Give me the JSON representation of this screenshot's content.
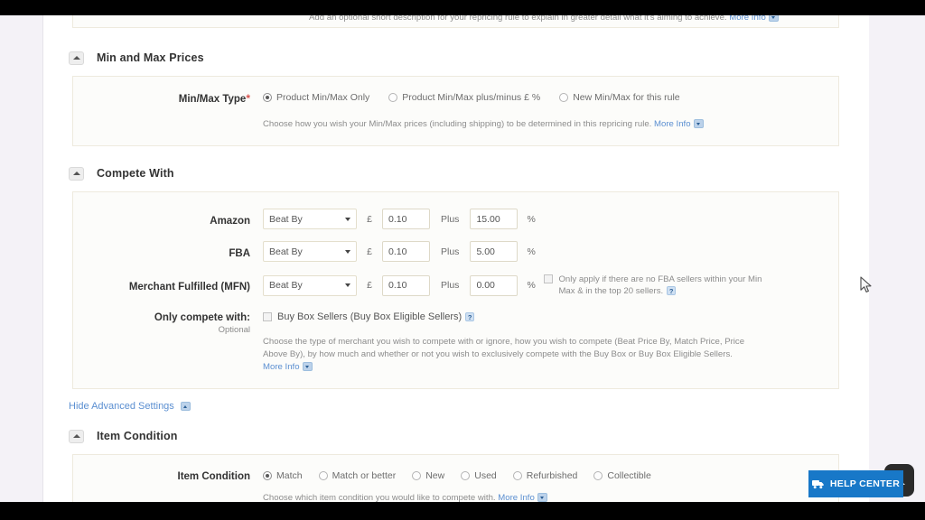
{
  "top_partial_panel": {
    "help_text": "Add an optional short description for your repricing rule to explain in greater detail what it's aiming to achieve.",
    "more_info": "More Info"
  },
  "sections": {
    "min_max": {
      "title": "Min and Max Prices",
      "field_label": "Min/Max Type",
      "required_mark": "*",
      "options": [
        {
          "label": "Product Min/Max Only",
          "selected": true
        },
        {
          "label": "Product Min/Max plus/minus £ %",
          "selected": false
        },
        {
          "label": "New Min/Max for this rule",
          "selected": false
        }
      ],
      "help_text": "Choose how you wish your Min/Max prices (including shipping) to be determined in this repricing rule.",
      "more_info": "More Info"
    },
    "compete_with": {
      "title": "Compete With",
      "rows": [
        {
          "label": "Amazon",
          "strategy": "Beat By",
          "currency": "£",
          "amount": "0.10",
          "plus_label": "Plus",
          "percent": "15.00",
          "percent_symbol": "%"
        },
        {
          "label": "FBA",
          "strategy": "Beat By",
          "currency": "£",
          "amount": "0.10",
          "plus_label": "Plus",
          "percent": "5.00",
          "percent_symbol": "%"
        },
        {
          "label": "Merchant Fulfilled (MFN)",
          "strategy": "Beat By",
          "currency": "£",
          "amount": "0.10",
          "plus_label": "Plus",
          "percent": "0.00",
          "percent_symbol": "%",
          "note": "Only apply if there are no FBA sellers within your Min Max & in the top 20 sellers.",
          "note_checked": false
        }
      ],
      "only_compete": {
        "label": "Only compete with:",
        "sub_label": "Optional",
        "checkbox_label": "Buy Box Sellers (Buy Box Eligible Sellers)",
        "checked": false
      },
      "help_text": "Choose the type of merchant you wish to compete with or ignore, how you wish to compete (Beat Price By, Match Price, Price Above By), by how much and whether or not you wish to exclusively compete with the Buy Box or Buy Box Eligible Sellers.",
      "more_info": "More Info"
    },
    "advanced_toggle": {
      "label": "Hide Advanced Settings"
    },
    "item_condition": {
      "title": "Item Condition",
      "field_label": "Item Condition",
      "options": [
        {
          "label": "Match",
          "selected": true
        },
        {
          "label": "Match or better",
          "selected": false
        },
        {
          "label": "New",
          "selected": false
        },
        {
          "label": "Used",
          "selected": false
        },
        {
          "label": "Refurbished",
          "selected": false
        },
        {
          "label": "Collectible",
          "selected": false
        }
      ],
      "help_text": "Choose which item condition you would like to compete with.",
      "more_info": "More Info"
    }
  },
  "widgets": {
    "help_center": {
      "label": "HELP CENTER",
      "icon": "support-truck-icon",
      "color": "#1878c8"
    },
    "scroll_top": {
      "icon": "chevron-up-icon",
      "color": "#2b2b2b"
    }
  }
}
